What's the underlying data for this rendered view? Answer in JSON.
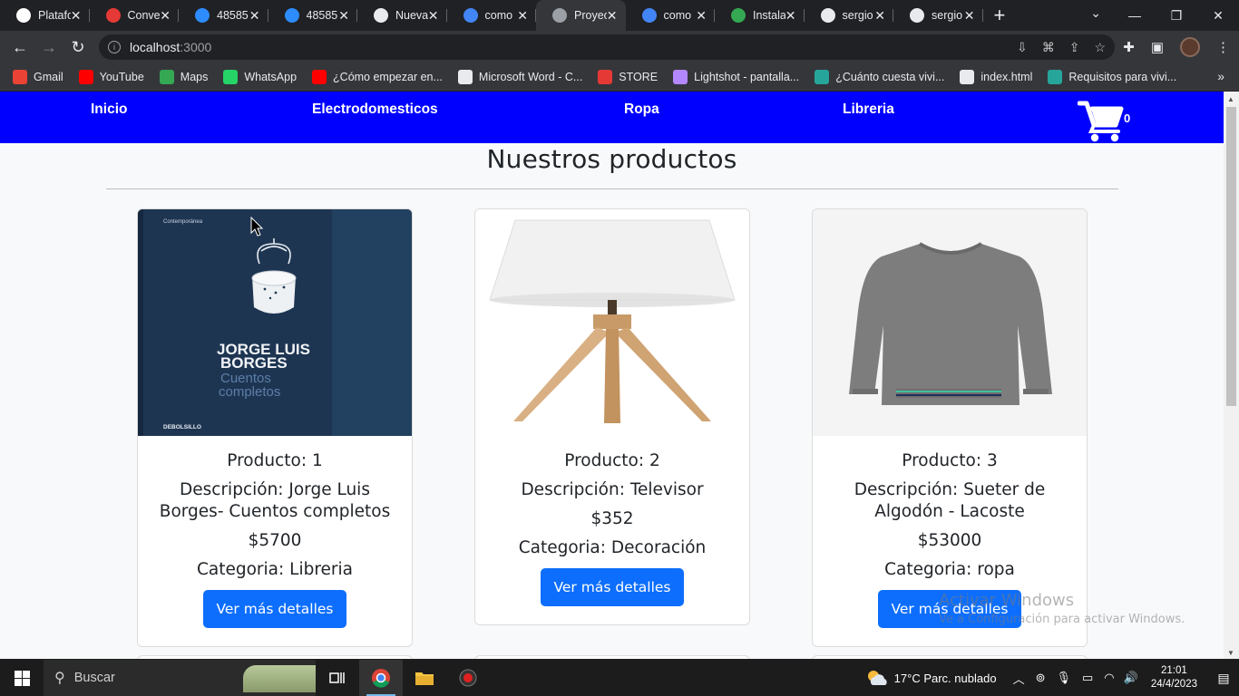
{
  "browser": {
    "tabs": [
      {
        "title": "Platafo",
        "icon": "platform-icon",
        "color": "#ffffff",
        "active": false
      },
      {
        "title": "Conve",
        "icon": "convert-icon",
        "color": "#e53935",
        "active": false
      },
      {
        "title": "48585",
        "icon": "zoom-icon",
        "color": "#2d8cff",
        "active": false
      },
      {
        "title": "48585",
        "icon": "zoom-icon",
        "color": "#2d8cff",
        "active": false
      },
      {
        "title": "Nueva",
        "icon": "chrome-icon",
        "color": "#e8eaed",
        "active": false
      },
      {
        "title": "como",
        "icon": "google-icon",
        "color": "#4285f4",
        "active": false
      },
      {
        "title": "Proyec",
        "icon": "pencil-icon",
        "color": "#9aa0a6",
        "active": true
      },
      {
        "title": "como",
        "icon": "google-icon",
        "color": "#4285f4",
        "active": false
      },
      {
        "title": "Instala",
        "icon": "drive-icon",
        "color": "#34a853",
        "active": false
      },
      {
        "title": "sergio",
        "icon": "github-icon",
        "color": "#e8eaed",
        "active": false
      },
      {
        "title": "sergio",
        "icon": "github-icon",
        "color": "#e8eaed",
        "active": false
      }
    ],
    "url_host": "localhost",
    "url_port": ":3000",
    "bookmarks": [
      {
        "label": "Gmail",
        "icon": "gmail-icon",
        "color": "#ea4335"
      },
      {
        "label": "YouTube",
        "icon": "youtube-icon",
        "color": "#ff0000"
      },
      {
        "label": "Maps",
        "icon": "maps-icon",
        "color": "#34a853"
      },
      {
        "label": "WhatsApp",
        "icon": "whatsapp-icon",
        "color": "#25d366"
      },
      {
        "label": "¿Cómo empezar en...",
        "icon": "youtube-icon",
        "color": "#ff0000"
      },
      {
        "label": "Microsoft Word - C...",
        "icon": "globe-icon",
        "color": "#e8eaed"
      },
      {
        "label": "STORE",
        "icon": "store-icon",
        "color": "#e53935"
      },
      {
        "label": "Lightshot - pantalla...",
        "icon": "feather-icon",
        "color": "#b388ff"
      },
      {
        "label": "¿Cuánto cuesta vivi...",
        "icon": "site-icon",
        "color": "#26a69a"
      },
      {
        "label": "index.html",
        "icon": "globe-icon",
        "color": "#e8eaed"
      },
      {
        "label": "Requisitos para vivi...",
        "icon": "site-icon",
        "color": "#26a69a"
      }
    ]
  },
  "nav": {
    "links": [
      "Inicio",
      "Electrodomesticos",
      "Ropa",
      "Libreria"
    ],
    "cart_count": "0",
    "bg_color": "#0000ff"
  },
  "heading": "Nuestros productos",
  "products": [
    {
      "name": "Producto: 1",
      "description": "Descripción: Jorge Luis Borges- Cuentos completos",
      "price": "$5700",
      "category": "Categoria: Libreria",
      "button": "Ver más detalles",
      "cover_publisher": "Contemporánea",
      "cover_author_1": "JORGE LUIS",
      "cover_author_2": "BORGES",
      "cover_title_1": "Cuentos",
      "cover_title_2": "completos",
      "cover_brand": "DEBOLSILLO"
    },
    {
      "name": "Producto: 2",
      "description": "Descripción: Televisor",
      "price": "$352",
      "category": "Categoria: Decoración",
      "button": "Ver más detalles"
    },
    {
      "name": "Producto: 3",
      "description": "Descripción: Sueter de Algodón - Lacoste",
      "price": "$53000",
      "category": "Categoria: ropa",
      "button": "Ver más detalles"
    }
  ],
  "watermark": {
    "line1": "Activar Windows",
    "line2": "Ve a Configuración para activar Windows."
  },
  "taskbar": {
    "search_placeholder": "Buscar",
    "weather": "17°C  Parc. nublado",
    "time": "21:01",
    "date": "24/4/2023"
  }
}
